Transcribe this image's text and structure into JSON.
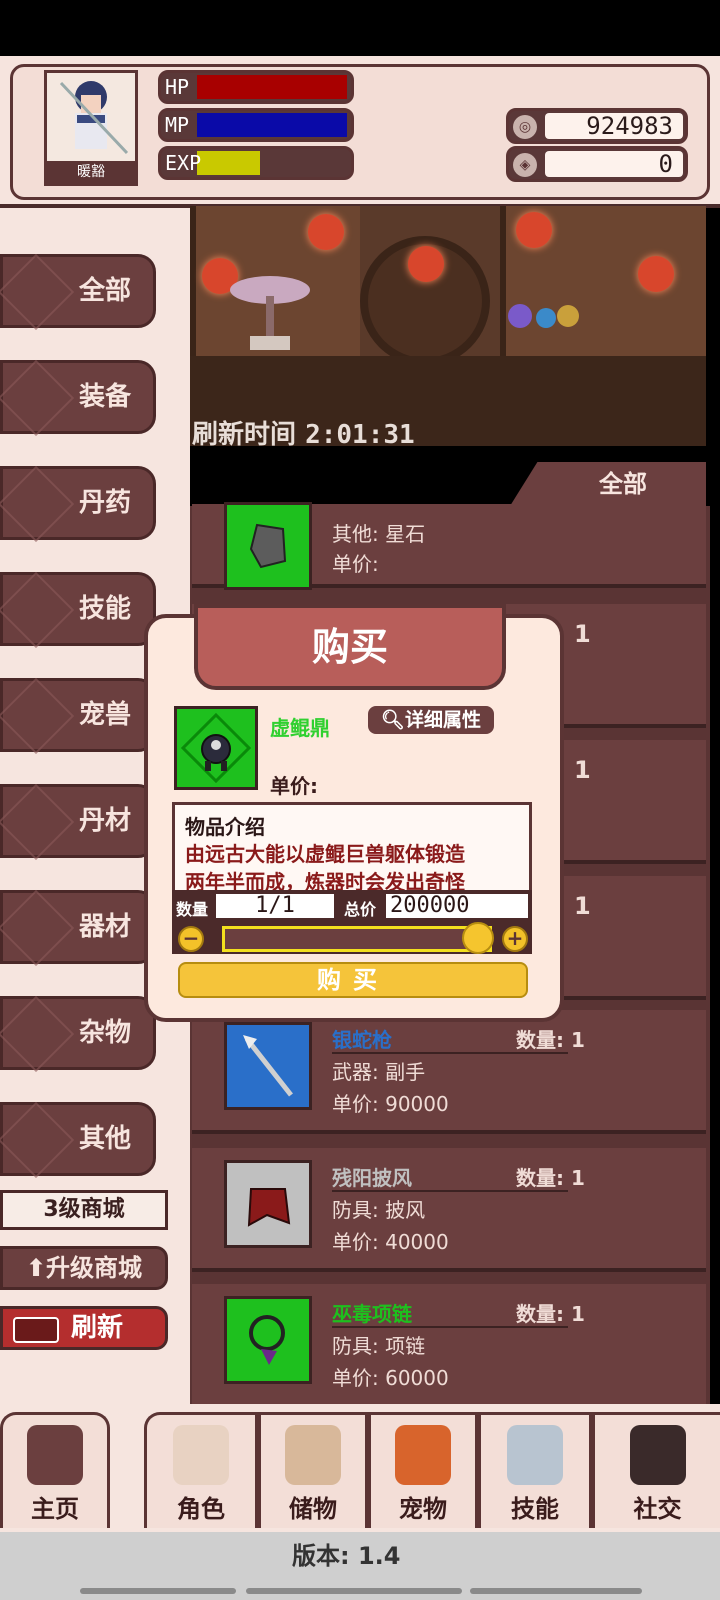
{
  "player": {
    "name": "暖豁",
    "hp_label": "HP",
    "mp_label": "MP",
    "exp_label": "EXP",
    "hp_fraction": 1.0,
    "mp_fraction": 1.0,
    "exp_fraction": 0.42,
    "coins": "924983",
    "gems": "0"
  },
  "categories": [
    "全部",
    "装备",
    "丹药",
    "技能",
    "宠兽",
    "丹材",
    "器材",
    "杂物",
    "其他"
  ],
  "shop": {
    "level_label": "3级商城",
    "upgrade_label": "升级商城",
    "refresh_label": "刷新",
    "refresh_time_label": "刷新时间",
    "refresh_time_value": "2:01:31",
    "filter_label": "全部"
  },
  "items": [
    {
      "name": "",
      "qty_label": "",
      "type": "其他: 星石",
      "price": "单价:",
      "color": "#1ec01e"
    },
    {
      "name": "",
      "qty_label": "1",
      "type": "",
      "price": "",
      "color": ""
    },
    {
      "name": "",
      "qty_label": "1",
      "type": "",
      "price": "",
      "color": ""
    },
    {
      "name": "",
      "qty_label": "1",
      "type": "",
      "price": "",
      "color": ""
    },
    {
      "name": "银蛇枪",
      "qty_label": "数量: 1",
      "type": "武器: 副手",
      "price": "单价: 90000",
      "color": "#2a6fc9"
    },
    {
      "name": "残阳披风",
      "qty_label": "数量: 1",
      "type": "防具: 披风",
      "price": "单价: 40000",
      "color": "#c0c0c0"
    },
    {
      "name": "巫毒项链",
      "qty_label": "数量: 1",
      "type": "防具: 项链",
      "price": "单价: 60000",
      "color": "#1ec01e"
    }
  ],
  "modal": {
    "title": "购买",
    "item_name": "虚鲲鼎",
    "detail_label": "详细属性",
    "unit_price_label": "单价:",
    "desc_header": "物品介绍",
    "desc_line1": "由远古大能以虚鲲巨兽躯体锻造",
    "desc_line2": "两年半而成，炼器时会发出奇怪",
    "qty_label": "数量",
    "qty_value": "1/1",
    "total_label": "总价",
    "total_value": "200000",
    "minus": "−",
    "plus": "+",
    "buy_label": "购买",
    "slider_fraction": 1.0
  },
  "tabs": [
    "主页",
    "角色",
    "储物",
    "宠物",
    "技能",
    "社交"
  ],
  "version_text": "版本: 1.4",
  "colors": {
    "hp": "#a80000",
    "mp": "#0a0aa8",
    "exp": "#c9c900",
    "accent": "#6b3f3f",
    "gold": "#f5c43a"
  }
}
